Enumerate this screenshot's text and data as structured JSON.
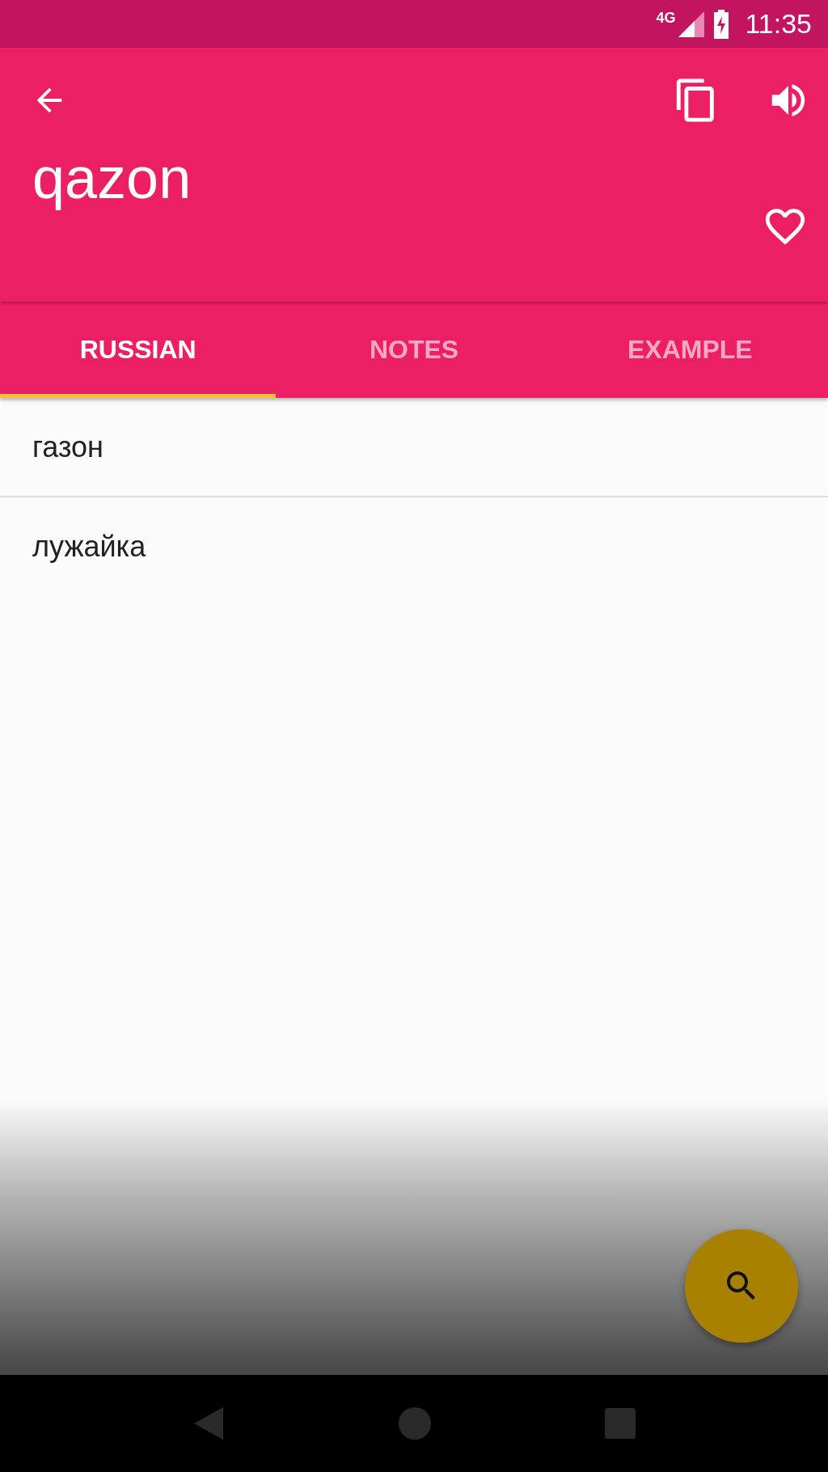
{
  "status_bar": {
    "network": "4G",
    "time": "11:35"
  },
  "toolbar": {
    "word": "qazon",
    "favorite": false
  },
  "tabs": [
    {
      "label": "RUSSIAN",
      "selected": true
    },
    {
      "label": "NOTES",
      "selected": false
    },
    {
      "label": "EXAMPLE",
      "selected": false
    }
  ],
  "translations": [
    "газон",
    "лужайка"
  ]
}
